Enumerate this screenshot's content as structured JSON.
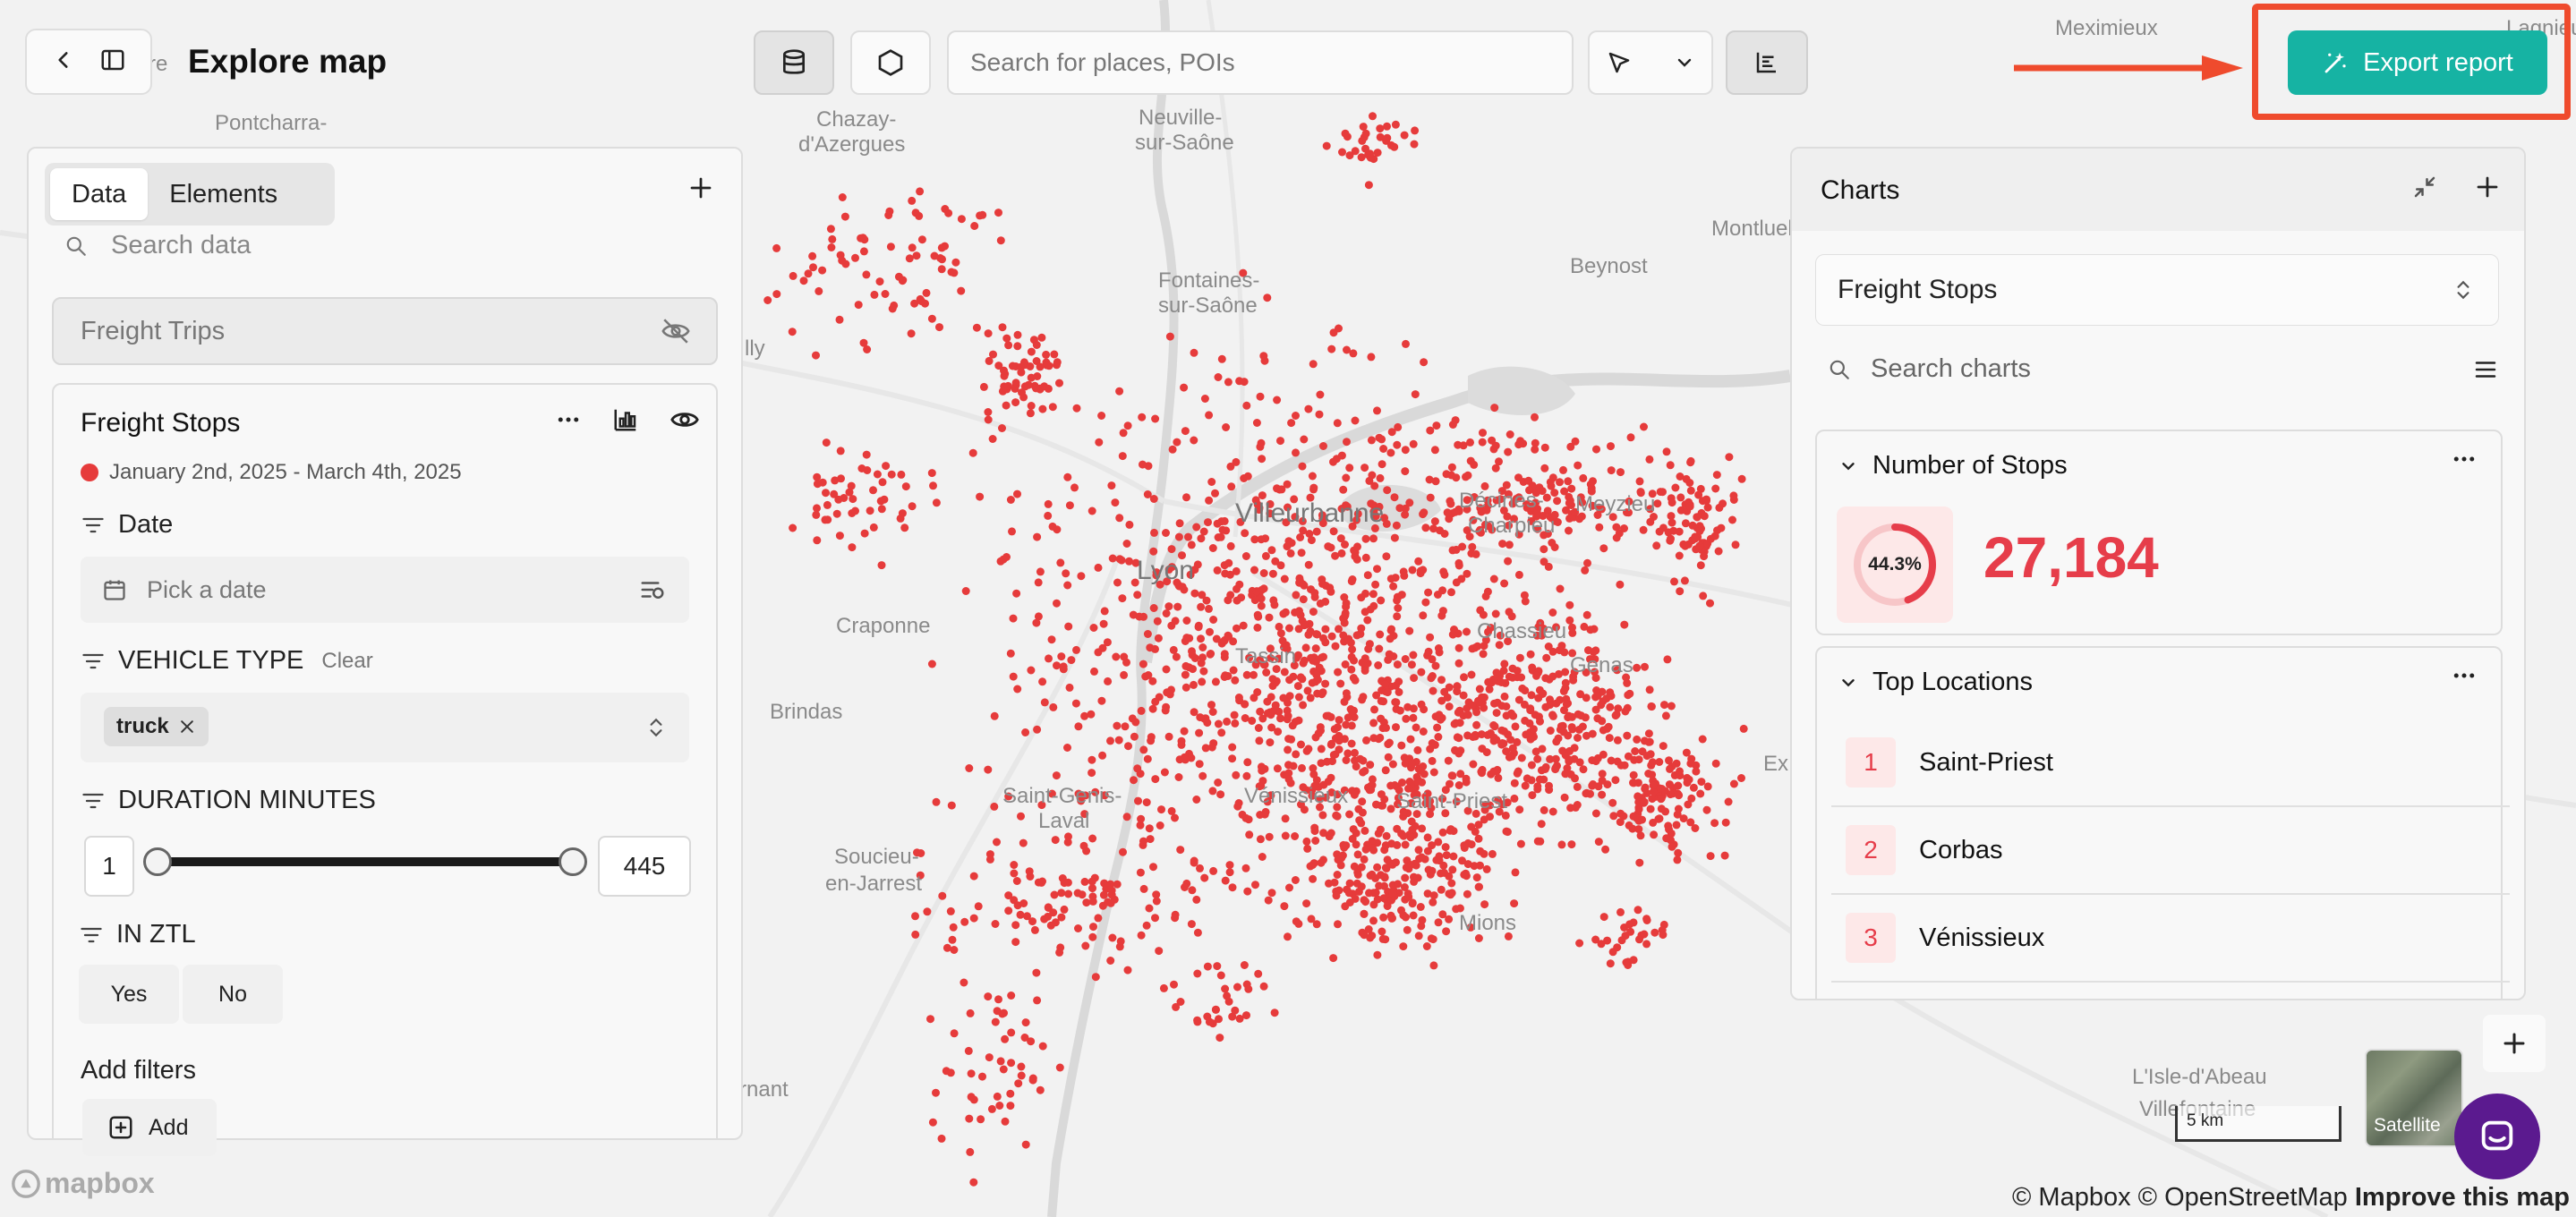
{
  "header": {
    "title": "Explore map",
    "search_placeholder": "Search for places, POIs",
    "export_label": "Export report"
  },
  "map": {
    "places": [
      "Pontcharra-",
      "Chazay-",
      "d'Azergues",
      "Neuville-",
      "sur-Saône",
      "Meximieux",
      "Montluel",
      "Beynost",
      "Fontaines-",
      "sur-Saône",
      "Villeurbanne",
      "Lyon",
      "Décines-",
      "Charpieu",
      "Meyzieu",
      "Chassieu",
      "Genas",
      "Craponne",
      "Brindas",
      "Saint-Genis-",
      "Laval",
      "Vénissieux",
      "Saint-Priest",
      "Soucieu-",
      "en-Jarrest",
      "Mions",
      "L'Isle-d'Abeau",
      "Villefontaine",
      "Lagnieu",
      "Tassin",
      "Ex",
      "rnant",
      "re",
      "lly"
    ],
    "scale_label": "5 km",
    "satellite_label": "Satellite",
    "attribution": "© Mapbox © OpenStreetMap",
    "attribution_link": "Improve this map",
    "logo": "mapbox",
    "points_color": "#e63b3b"
  },
  "left_panel": {
    "tabs": [
      "Data",
      "Elements"
    ],
    "search_placeholder": "Search data",
    "hidden_layer": "Freight Trips",
    "layer": {
      "title": "Freight Stops",
      "date_range": "January 2nd, 2025 - March 4th, 2025",
      "date_filter_label": "Date",
      "date_placeholder": "Pick a date",
      "vehicle_label": "VEHICLE TYPE",
      "clear_label": "Clear",
      "vehicle_chip": "truck",
      "duration_label": "DURATION MINUTES",
      "duration_min": "1",
      "duration_max": "445",
      "ztl_label": "IN ZTL",
      "yes": "Yes",
      "no": "No",
      "add_filters": "Add filters",
      "add_label": "Add"
    }
  },
  "right_panel": {
    "title": "Charts",
    "selected_layer": "Freight Stops",
    "search_placeholder": "Search charts",
    "stops_card": {
      "title": "Number of Stops",
      "percent_label": "44.3%",
      "percent": 0.443,
      "value": "27,184"
    },
    "locations_card": {
      "title": "Top Locations",
      "items": [
        {
          "rank": "1",
          "name": "Saint-Priest"
        },
        {
          "rank": "2",
          "name": "Corbas"
        },
        {
          "rank": "3",
          "name": "Vénissieux"
        }
      ]
    }
  },
  "colors": {
    "accent": "#16b3a3",
    "highlight": "#ef4b2d",
    "data_red": "#e63d4a"
  }
}
